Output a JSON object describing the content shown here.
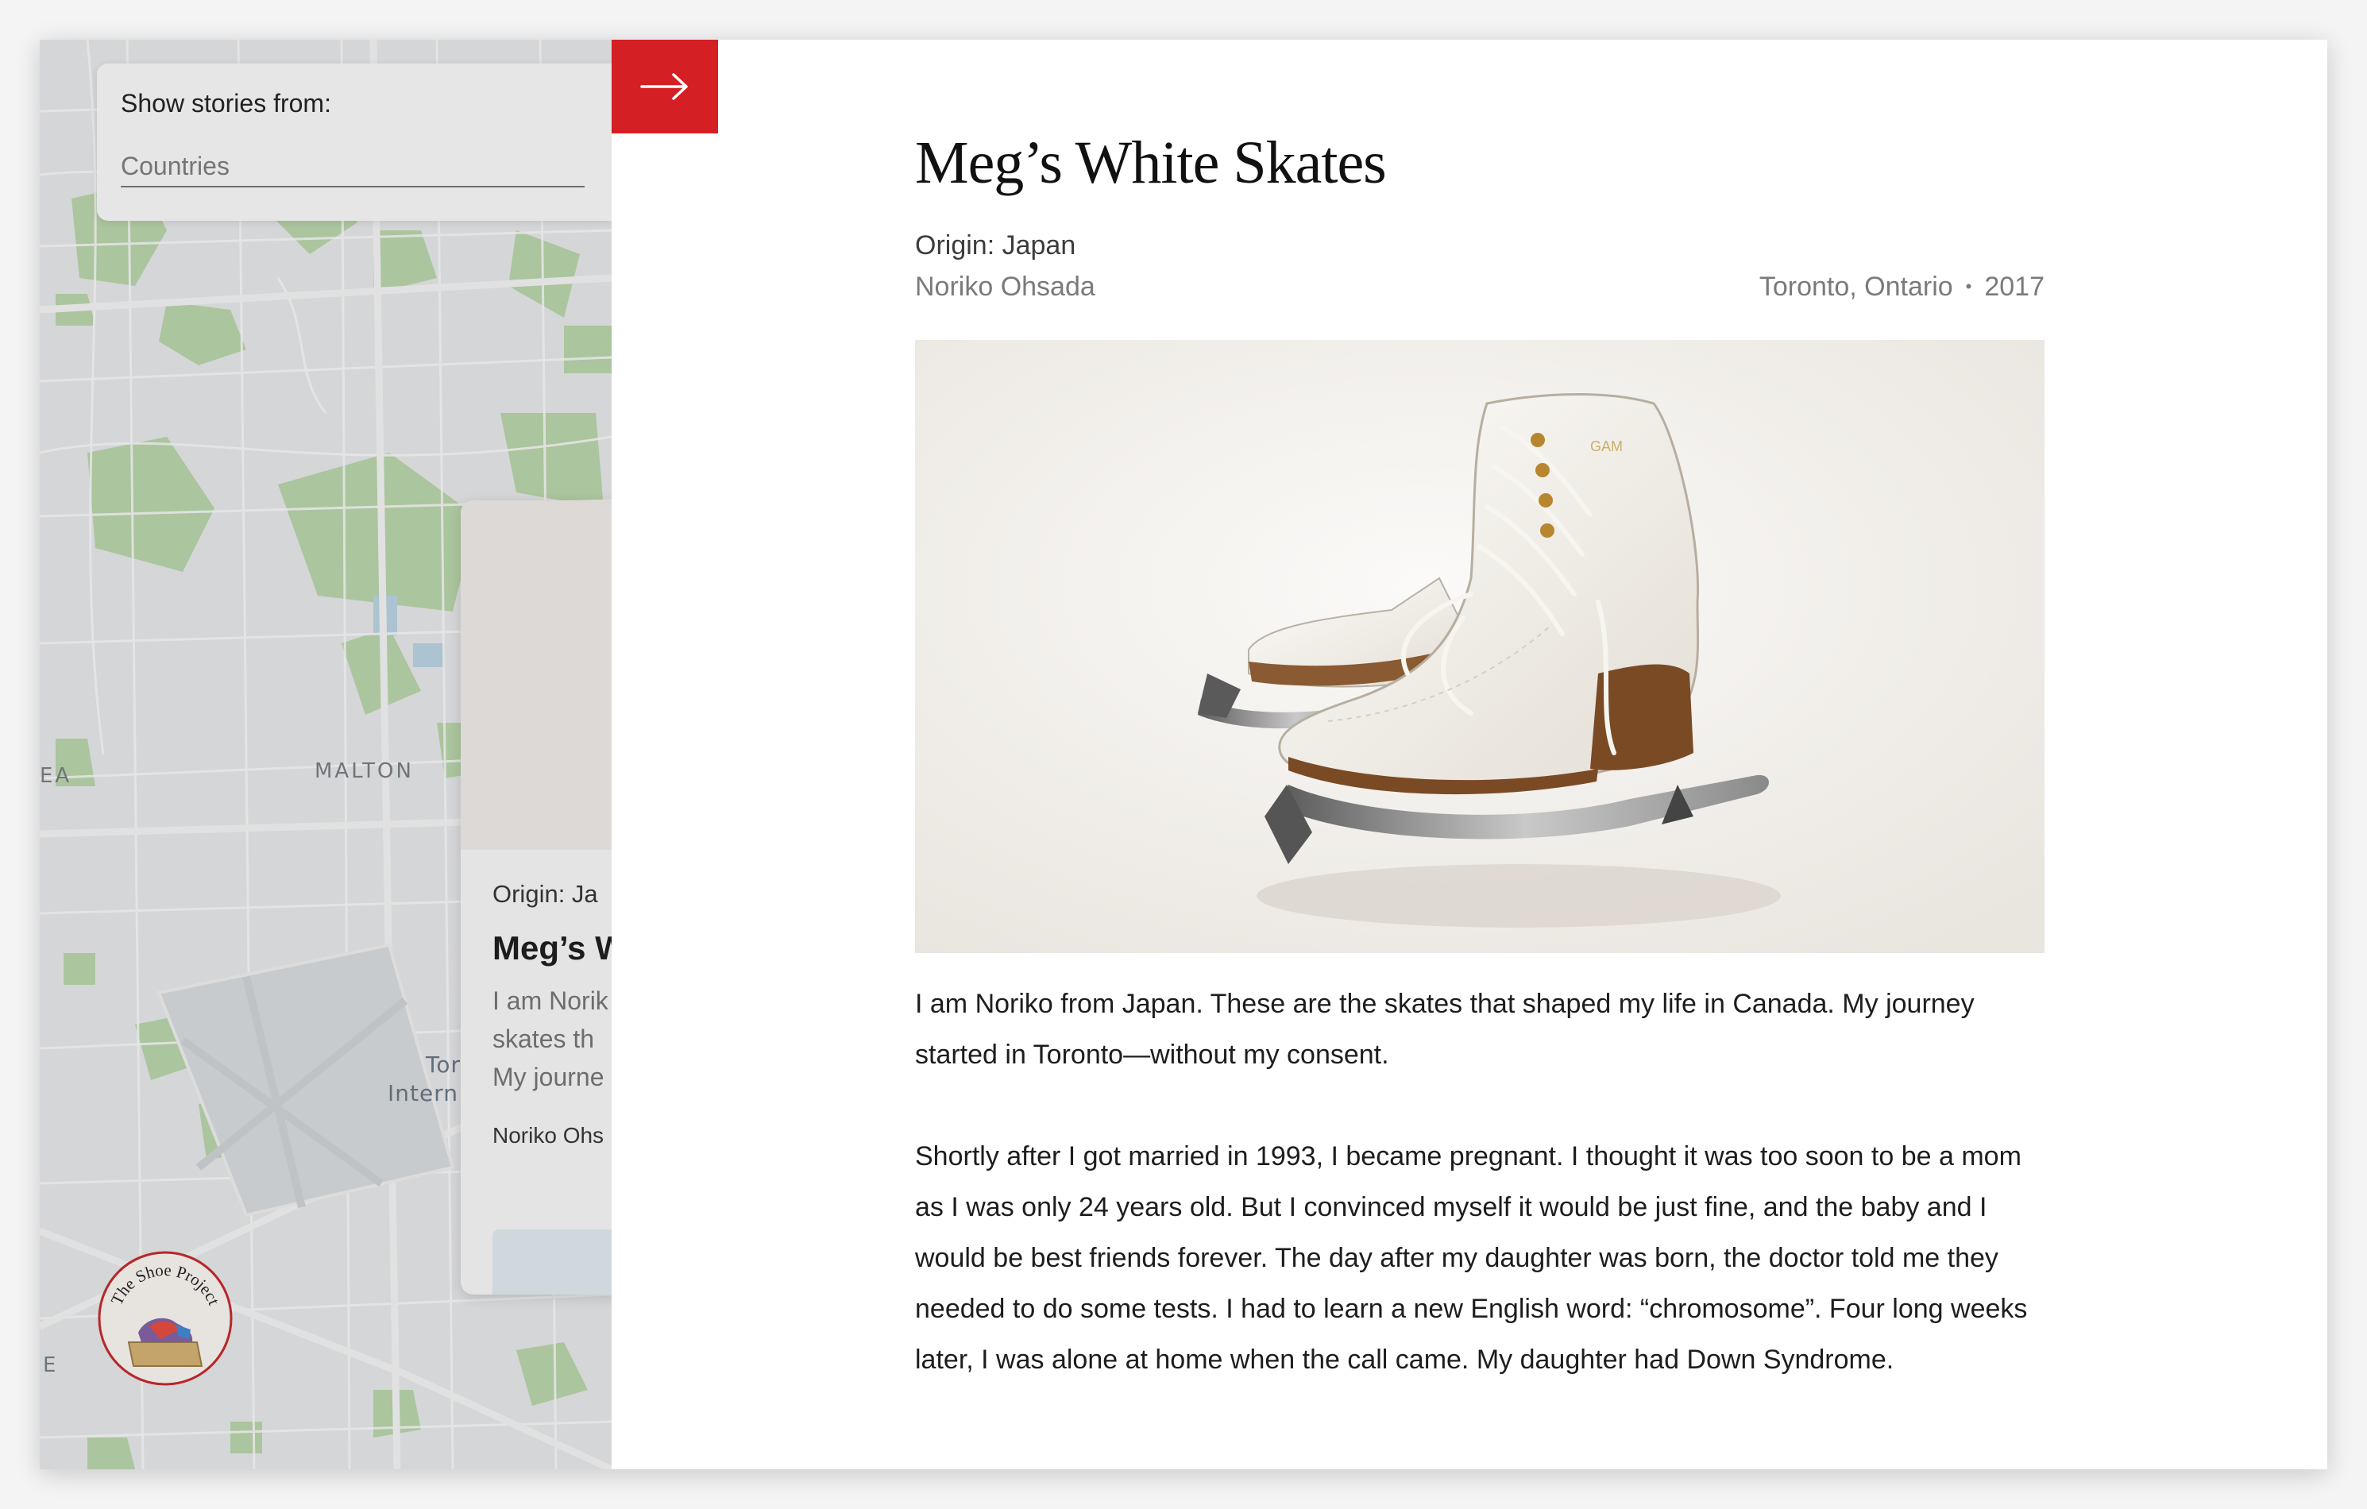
{
  "filter": {
    "title": "Show stories from:",
    "placeholder": "Countries"
  },
  "map": {
    "labels": [
      "MALTON",
      "EA",
      "Toro",
      "Intern",
      "E"
    ]
  },
  "story_card": {
    "origin": "Origin: Ja",
    "title": "Meg’s W",
    "excerpt_lines": [
      "I am Norik",
      "skates th",
      "My journe"
    ],
    "author": "Noriko Ohs"
  },
  "logo": {
    "text": "The Shoe Project"
  },
  "close_icon": "arrow-right-icon",
  "story": {
    "title": "Meg’s White Skates",
    "origin": "Origin: Japan",
    "author": "Noriko Ohsada",
    "location": "Toronto, Ontario",
    "separator": "•",
    "year": "2017",
    "paragraphs": [
      "I am Noriko from Japan. These are the skates that shaped my life in Canada. My journey started in Toronto—without my consent.",
      "Shortly after I got married in 1993, I became pregnant. I thought it was too soon to be a mom as I was only 24 years old. But I convinced myself it would be just fine, and the baby and I would be best friends forever. The day after my daughter was born, the doctor told me they needed to do some tests. I had to learn a new English word: “chromosome”. Four long weeks later, I was alone at home when the call came. My daughter had Down Syndrome."
    ]
  },
  "colors": {
    "accent": "#d41f24",
    "map_bg": "#e8eaec",
    "park": "#a9cf9a"
  }
}
